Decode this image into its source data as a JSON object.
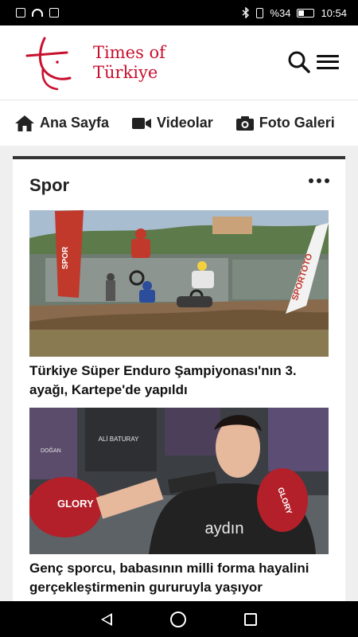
{
  "status_bar": {
    "battery_text": "%34",
    "time": "10:54",
    "left_icons": [
      "notification-icon",
      "wifi-icon",
      "nfc-icon"
    ],
    "right_icons": [
      "bluetooth-icon",
      "vibrate-icon",
      "battery-icon"
    ]
  },
  "header": {
    "brand_line1": "Times of",
    "brand_line2": "Türkiye",
    "accent_color": "#c8102e"
  },
  "nav": {
    "items": [
      {
        "label": "Ana Sayfa",
        "icon": "home-icon"
      },
      {
        "label": "Videolar",
        "icon": "video-camera-icon"
      },
      {
        "label": "Foto Galeri",
        "icon": "photo-camera-icon"
      }
    ]
  },
  "section": {
    "title": "Spor"
  },
  "articles": [
    {
      "title": "Türkiye Süper Enduro Şampiyonası'nın 3. ayağı, Kartepe'de yapıldı",
      "image": "motocross-riders-photo"
    },
    {
      "title": "Genç sporcu, babasının milli forma hayalini gerçekleştirmenin gururuyla yaşıyor",
      "image": "boxer-with-gloves-photo"
    }
  ],
  "photo_text": {
    "sign_red": "SPOR",
    "sign_white": "SPORTOTO",
    "poster_name": "ALİ BATURAY",
    "poster_left": "DOĞAN",
    "shirt_brand": "aydın",
    "glove_brand": "GLORY"
  }
}
